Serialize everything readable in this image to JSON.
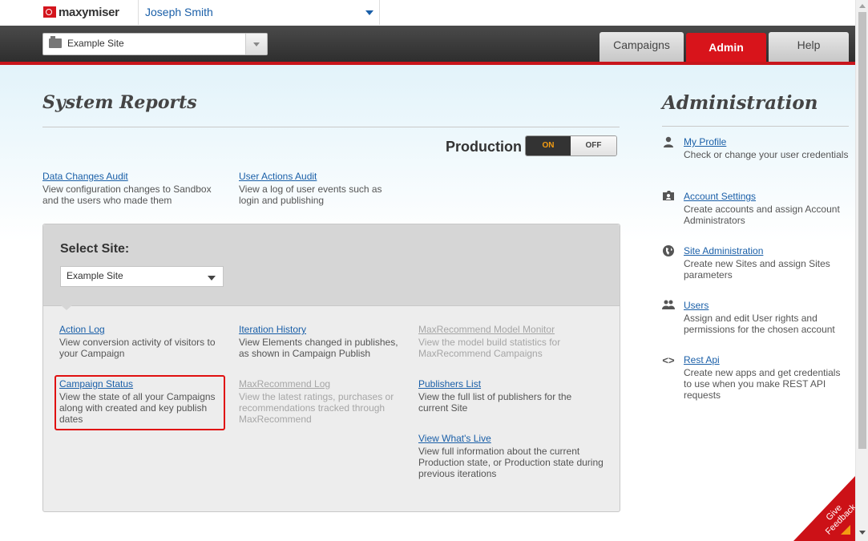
{
  "header": {
    "logo_text": "maxymiser",
    "user_name": "Joseph Smith",
    "site_selector": "Example Site",
    "tabs": [
      {
        "label": "Campaigns"
      },
      {
        "label": "Admin"
      },
      {
        "label": "Help"
      }
    ],
    "active_tab": "Admin",
    "accent_color": "#d8141b"
  },
  "system_reports": {
    "title": "System Reports",
    "production_label": "Production",
    "toggle_on": "ON",
    "toggle_off": "OFF",
    "toggle_state": "ON",
    "top_reports": [
      {
        "link": "Data Changes Audit",
        "desc": "View configuration changes to Sandbox and the users who made them"
      },
      {
        "link": "User Actions Audit",
        "desc": "View a log of user events such as login and publishing"
      }
    ],
    "select_site_label": "Select Site:",
    "select_site_value": "Example Site",
    "reports": [
      {
        "link": "Action Log",
        "desc": "View conversion activity of visitors to your Campaign",
        "enabled": true
      },
      {
        "link": "Iteration History",
        "desc": "View Elements changed in publishes, as shown in Campaign Publish",
        "enabled": true
      },
      {
        "link": "MaxRecommend Model Monitor",
        "desc": "View the model build statistics for MaxRecommend Campaigns",
        "enabled": false
      },
      {
        "link": "Campaign Status",
        "desc": "View the state of all your Campaigns along with created and key publish dates",
        "enabled": true
      },
      {
        "link": "MaxRecommend Log",
        "desc": "View the latest ratings, purchases or recommendations tracked through MaxRecommend",
        "enabled": false
      },
      {
        "link": "Publishers List",
        "desc": "View the full list of publishers for the current Site",
        "enabled": true
      },
      {
        "link": "View What's Live",
        "desc": "View full information about the current Production state, or Production state during previous iterations",
        "enabled": true
      }
    ]
  },
  "administration": {
    "title": "Administration",
    "items": [
      {
        "icon": "user-icon",
        "link": "My Profile",
        "desc": "Check or change your user credentials"
      },
      {
        "icon": "account-settings-icon",
        "link": "Account Settings",
        "desc": "Create accounts and assign Account Administrators"
      },
      {
        "icon": "globe-icon",
        "link": "Site Administration",
        "desc": "Create new Sites and assign Sites parameters"
      },
      {
        "icon": "users-icon",
        "link": "Users",
        "desc": "Assign and edit User rights and permissions for the chosen account"
      },
      {
        "icon": "code-icon",
        "link": "Rest Api",
        "desc": "Create new apps and get credentials to use when you make REST API requests"
      }
    ]
  },
  "feedback": {
    "label_line1": "Give",
    "label_line2": "Feedback"
  }
}
